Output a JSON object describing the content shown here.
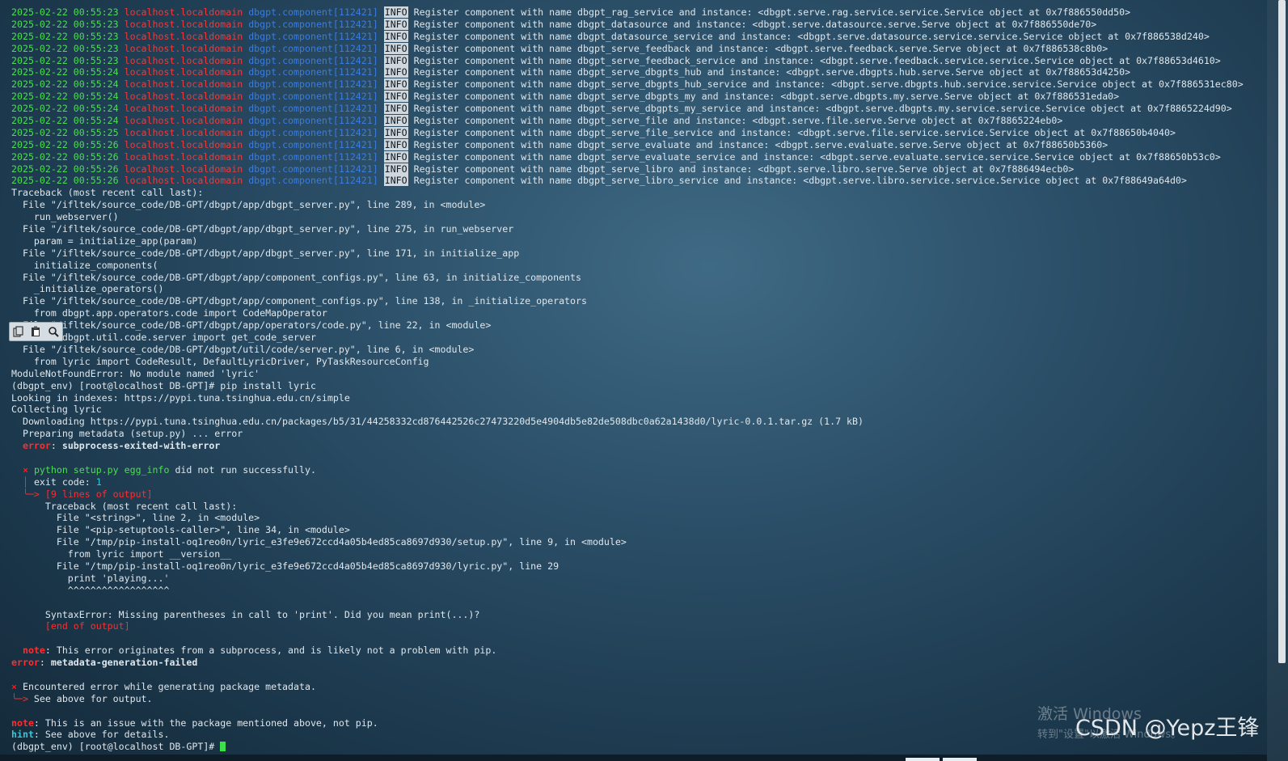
{
  "log": {
    "timestamps": [
      "2025-02-22 00:55:23",
      "2025-02-22 00:55:23",
      "2025-02-22 00:55:23",
      "2025-02-22 00:55:23",
      "2025-02-22 00:55:23",
      "2025-02-22 00:55:24",
      "2025-02-22 00:55:24",
      "2025-02-22 00:55:24",
      "2025-02-22 00:55:24",
      "2025-02-22 00:55:24",
      "2025-02-22 00:55:25",
      "2025-02-22 00:55:26",
      "2025-02-22 00:55:26",
      "2025-02-22 00:55:26",
      "2025-02-22 00:55:26"
    ],
    "host": "localhost.localdomain",
    "component": "dbgpt.component[112421]",
    "level": "INFO",
    "messages": [
      "Register component with name dbgpt_rag_service and instance: <dbgpt.serve.rag.service.service.Service object at 0x7f886550dd50>",
      "Register component with name dbgpt_datasource and instance: <dbgpt.serve.datasource.serve.Serve object at 0x7f886550de70>",
      "Register component with name dbgpt_datasource_service and instance: <dbgpt.serve.datasource.service.service.Service object at 0x7f886538d240>",
      "Register component with name dbgpt_serve_feedback and instance: <dbgpt.serve.feedback.serve.Serve object at 0x7f886538c8b0>",
      "Register component with name dbgpt_serve_feedback_service and instance: <dbgpt.serve.feedback.service.service.Service object at 0x7f88653d4610>",
      "Register component with name dbgpt_serve_dbgpts_hub and instance: <dbgpt.serve.dbgpts.hub.serve.Serve object at 0x7f88653d4250>",
      "Register component with name dbgpt_serve_dbgpts_hub_service and instance: <dbgpt.serve.dbgpts.hub.service.service.Service object at 0x7f886531ec80>",
      "Register component with name dbgpt_serve_dbgpts_my and instance: <dbgpt.serve.dbgpts.my.serve.Serve object at 0x7f886531eda0>",
      "Register component with name dbgpt_serve_dbgpts_my_service and instance: <dbgpt.serve.dbgpts.my.service.service.Service object at 0x7f8865224d90>",
      "Register component with name dbgpt_serve_file and instance: <dbgpt.serve.file.serve.Serve object at 0x7f8865224eb0>",
      "Register component with name dbgpt_serve_file_service and instance: <dbgpt.serve.file.service.service.Service object at 0x7f88650b4040>",
      "Register component with name dbgpt_serve_evaluate and instance: <dbgpt.serve.evaluate.serve.Serve object at 0x7f88650b5360>",
      "Register component with name dbgpt_serve_evaluate_service and instance: <dbgpt.serve.evaluate.service.service.Service object at 0x7f88650b53c0>",
      "Register component with name dbgpt_serve_libro and instance: <dbgpt.serve.libro.serve.Serve object at 0x7f886494ecb0>",
      "Register component with name dbgpt_serve_libro_service and instance: <dbgpt.serve.libro.service.service.Service object at 0x7f88649a64d0>"
    ]
  },
  "traceback": [
    "Traceback (most recent call last):",
    "  File \"/ifltek/source_code/DB-GPT/dbgpt/app/dbgpt_server.py\", line 289, in <module>",
    "    run_webserver()",
    "  File \"/ifltek/source_code/DB-GPT/dbgpt/app/dbgpt_server.py\", line 275, in run_webserver",
    "    param = initialize_app(param)",
    "  File \"/ifltek/source_code/DB-GPT/dbgpt/app/dbgpt_server.py\", line 171, in initialize_app",
    "    initialize_components(",
    "  File \"/ifltek/source_code/DB-GPT/dbgpt/app/component_configs.py\", line 63, in initialize_components",
    "    _initialize_operators()",
    "  File \"/ifltek/source_code/DB-GPT/dbgpt/app/component_configs.py\", line 138, in _initialize_operators",
    "    from dbgpt.app.operators.code import CodeMapOperator",
    "  File \"/ifltek/source_code/DB-GPT/dbgpt/app/operators/code.py\", line 22, in <module>",
    "    from dbgpt.util.code.server import get_code_server",
    "  File \"/ifltek/source_code/DB-GPT/dbgpt/util/code/server.py\", line 6, in <module>",
    "    from lyric import CodeResult, DefaultLyricDriver, PyTaskResourceConfig",
    "ModuleNotFoundError: No module named 'lyric'"
  ],
  "session": {
    "prompt": "(dbgpt_env) [root@localhost DB-GPT]# ",
    "command": "pip install lyric",
    "looking": "Looking in indexes: https://pypi.tuna.tsinghua.edu.cn/simple",
    "collecting": "Collecting lyric",
    "downloading": "  Downloading https://pypi.tuna.tsinghua.edu.cn/packages/b5/31/44258332cd876442526c27473220d5e4904db5e82de508dbc0a62a1438d0/lyric-0.0.1.tar.gz (1.7 kB)",
    "preparing": "  Preparing metadata (setup.py) ... error",
    "error_word": "error",
    "subprocess_error": "subprocess-exited-with-error",
    "cross": "×",
    "python_cmd": "python setup.py egg_info",
    "did_not_run": " did not run successfully.",
    "exit_code_label": "exit code: ",
    "exit_code": "1",
    "lines_of_output": "[9 lines of output]",
    "inner_traceback": [
      "Traceback (most recent call last):",
      "  File \"<string>\", line 2, in <module>",
      "  File \"<pip-setuptools-caller>\", line 34, in <module>",
      "  File \"/tmp/pip-install-oq1reo0n/lyric_e3fe9e672ccd4a05b4ed85ca8697d930/setup.py\", line 9, in <module>",
      "    from lyric import __version__",
      "  File \"/tmp/pip-install-oq1reo0n/lyric_e3fe9e672ccd4a05b4ed85ca8697d930/lyric.py\", line 29",
      "    print 'playing...'",
      "    ^^^^^^^^^^^^^^^^^^",
      "",
      "SyntaxError: Missing parentheses in call to 'print'. Did you mean print(...)?"
    ],
    "end_of_output": "[end of output]",
    "note_word": "note",
    "note1": ": This error originates from a subprocess, and is likely not a problem with pip.",
    "metadata_failed": "metadata-generation-failed",
    "encountered": " Encountered error while generating package metadata.",
    "see_above": " See above for output.",
    "note2": ": This is an issue with the package mentioned above, not pip.",
    "hint_word": "hint",
    "hint": ": See above for details."
  },
  "toolbar": {
    "copy_icon": "copy-icon",
    "paste_icon": "paste-icon",
    "search_icon": "search-icon"
  },
  "watermark": {
    "activate_title": "激活 Windows",
    "activate_sub": "转到\"设置\"以激活 Windows。",
    "csdn": "CSDN @Yepz王锋"
  }
}
